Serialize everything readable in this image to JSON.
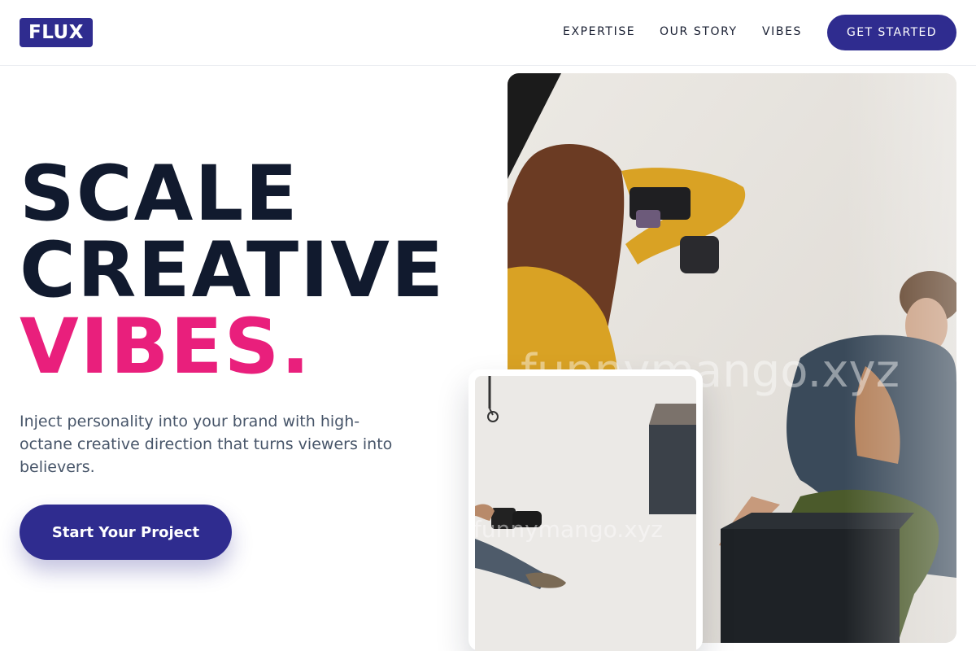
{
  "header": {
    "logo": "FLUX",
    "nav": [
      {
        "label": "EXPERTISE"
      },
      {
        "label": "OUR STORY"
      },
      {
        "label": "VIBES"
      }
    ],
    "cta_label": "GET STARTED"
  },
  "hero": {
    "headline_lines": [
      "SCALE",
      "CREATIVE",
      "VIBES."
    ],
    "description": "Inject personality into your brand with high-octane creative direction that turns viewers into believers.",
    "primary_cta": "Start Your Project"
  },
  "images": {
    "main_photo": {
      "description_icon": "photo-shoot-image",
      "watermark": "funnymango.xyz"
    },
    "inset_photo": {
      "description_icon": "photographer-floor-image",
      "watermark": "funnymango.xyz"
    }
  },
  "colors": {
    "brand": "#2f2c8f",
    "accent": "#e91f7c",
    "heading": "#111a2e",
    "body_text": "#475569"
  }
}
